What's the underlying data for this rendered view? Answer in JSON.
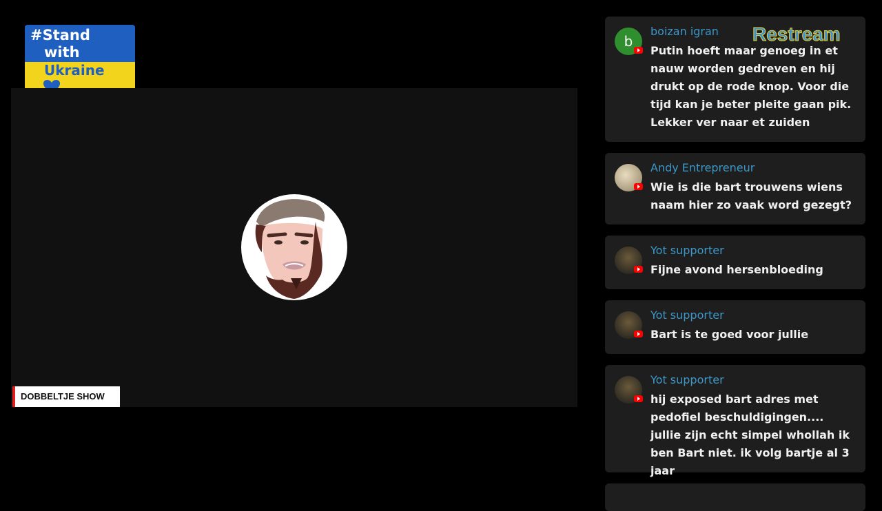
{
  "badge": {
    "line1": "#Stand",
    "line2": "with",
    "line3": "Ukraine"
  },
  "stage": {
    "show_name": "DOBBELTJE SHOW"
  },
  "chat": {
    "brand": "Restream",
    "messages": [
      {
        "author": "boizan igran",
        "avatar_letter": "b",
        "text": "Putin hoeft maar genoeg in et nauw worden gedreven en hij drukt op de rode knop. Voor die tijd kan je beter pleite gaan pik. Lekker ver naar et zuiden"
      },
      {
        "author": "Andy Entrepreneur",
        "text": "Wie is die bart trouwens wiens naam hier zo vaak word gezegt?"
      },
      {
        "author": "Yot supporter",
        "text": "Fijne avond hersenbloeding"
      },
      {
        "author": "Yot supporter",
        "text": "Bart is te goed voor jullie"
      },
      {
        "author": "Yot supporter",
        "text": "hij exposed bart adres met pedofiel beschuldigingen.... jullie zijn echt simpel whollah ik ben Bart niet. ik volg bartje al 3 jaar"
      }
    ]
  },
  "icons": {
    "youtube": "youtube-icon",
    "heart": "heart-icon"
  },
  "colors": {
    "accent_blue": "#3d98c9",
    "ukraine_blue": "#1f5fbf",
    "ukraine_yellow": "#f2d41c",
    "live_red": "#e02020"
  }
}
